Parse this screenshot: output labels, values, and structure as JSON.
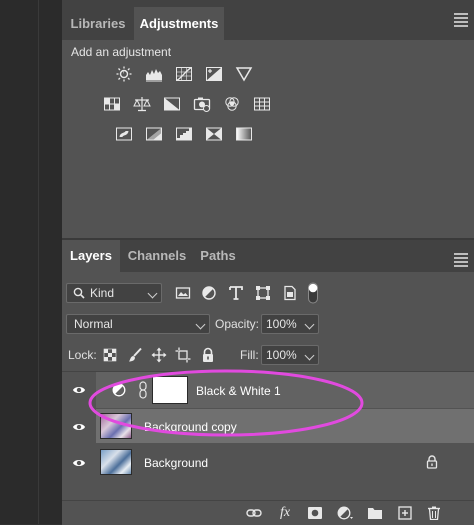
{
  "colors": {
    "panel": "#535353",
    "tabbar": "#424242",
    "selected_row": "#6a6a6a",
    "highlight": "#e14adf"
  },
  "adjustments": {
    "tabs": [
      {
        "label": "Libraries"
      },
      {
        "label": "Adjustments"
      }
    ],
    "title": "Add an adjustment",
    "icons_row1": [
      "brightness-contrast-icon",
      "levels-icon",
      "curves-icon",
      "exposure-icon",
      "vibrance-icon"
    ],
    "icons_row2": [
      "hue-saturation-icon",
      "color-balance-icon",
      "black-white-icon",
      "photo-filter-icon",
      "channel-mixer-icon",
      "color-lookup-icon"
    ],
    "icons_row3": [
      "invert-icon",
      "posterize-icon",
      "threshold-icon",
      "selective-color-icon",
      "gradient-map-icon"
    ]
  },
  "layers": {
    "tabs": [
      {
        "label": "Layers"
      },
      {
        "label": "Channels"
      },
      {
        "label": "Paths"
      }
    ],
    "filter_kind": "Kind",
    "blend_mode": "Normal",
    "opacity_label": "Opacity:",
    "opacity_value": "100%",
    "lock_label": "Lock:",
    "fill_label": "Fill:",
    "fill_value": "100%",
    "items": [
      {
        "name": "Black & White 1",
        "type": "adjustment"
      },
      {
        "name": "Background copy",
        "type": "image",
        "selected": true
      },
      {
        "name": "Background",
        "type": "image",
        "locked": true
      }
    ]
  },
  "bottom_icons": [
    "link-layers-icon",
    "fx-icon",
    "add-mask-icon",
    "new-adjustment-icon",
    "new-group-icon",
    "new-layer-icon",
    "delete-icon"
  ]
}
